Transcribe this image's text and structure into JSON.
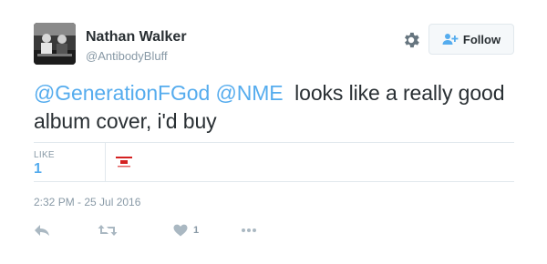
{
  "user": {
    "name": "Nathan Walker",
    "handle": "@AntibodyBluff"
  },
  "follow_button": {
    "label": "Follow"
  },
  "tweet": {
    "mentions": [
      "@GenerationFGod",
      "@NME"
    ],
    "text": "  looks like a really good album cover, i'd buy"
  },
  "stats": {
    "likes_label": "LIKE",
    "likes_value": "1"
  },
  "timestamp": "2:32 PM - 25 Jul 2016",
  "actions": {
    "like_count": "1"
  },
  "colors": {
    "link": "#55acee",
    "muted": "#8899a6",
    "text": "#292f33"
  },
  "icons": [
    "settings-gear-icon",
    "follow-person-plus-icon",
    "reply-arrow-icon",
    "retweet-icon",
    "heart-icon",
    "more-dots-icon"
  ]
}
